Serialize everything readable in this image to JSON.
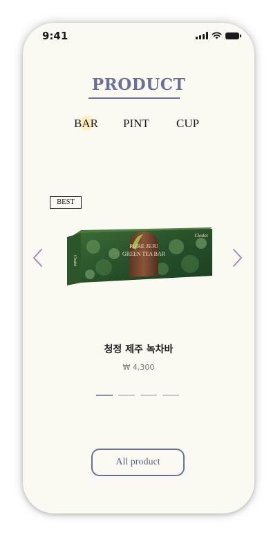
{
  "status_bar": {
    "time": "9:41"
  },
  "header": {
    "title": "PRODUCT"
  },
  "tabs": [
    {
      "label": "BAR",
      "active": true
    },
    {
      "label": "PINT",
      "active": false
    },
    {
      "label": "CUP",
      "active": false
    }
  ],
  "product": {
    "badge": "BEST",
    "name": "청정 제주 녹차바",
    "price": "₩ 4,300",
    "package_brand": "Clodot",
    "package_line1": "PURE JEJU",
    "package_line2": "GREEN TEA BAR",
    "side_brand": "Clodot"
  },
  "pager": {
    "total": 4,
    "current": 1
  },
  "footer": {
    "button_label": "All product"
  },
  "colors": {
    "screen_bg": "#fbfaf2",
    "accent": "#6b7196",
    "arrow": "#a68bc0",
    "package_green": "#2f5a2c",
    "active_tab_glow": "#fce28c"
  },
  "icons": {
    "left_arrow": "chevron-left-icon",
    "right_arrow": "chevron-right-icon",
    "signal": "cellular-signal-icon",
    "wifi": "wifi-icon",
    "battery": "battery-icon"
  }
}
